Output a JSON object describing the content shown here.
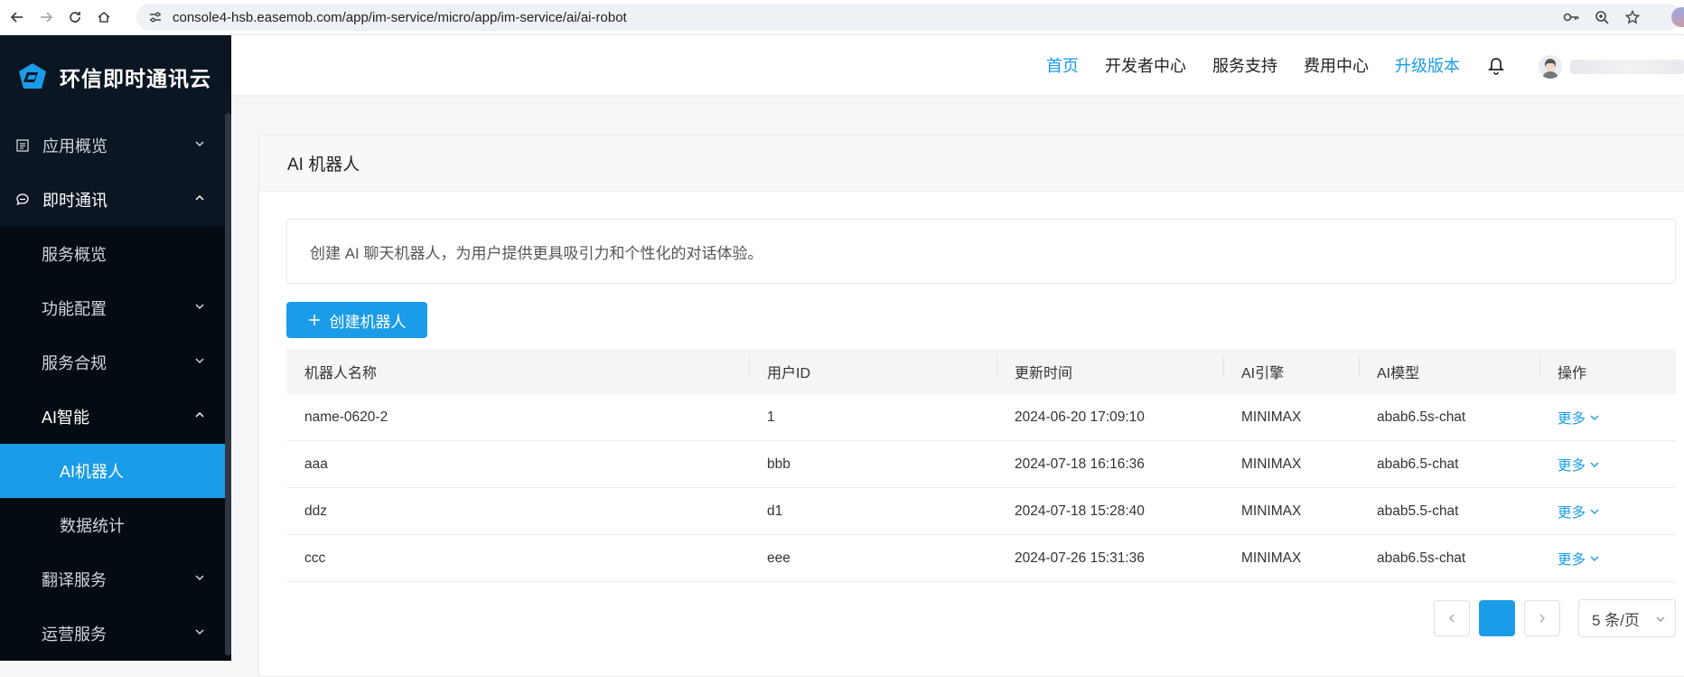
{
  "browser": {
    "url": "console4-hsb.easemob.com/app/im-service/micro/app/im-service/ai/ai-robot"
  },
  "sidebar": {
    "brand": "环信即时通讯云",
    "items": [
      {
        "label": "应用概览"
      },
      {
        "label": "即时通讯"
      },
      {
        "label": "服务概览"
      },
      {
        "label": "功能配置"
      },
      {
        "label": "服务合规"
      },
      {
        "label": "AI智能"
      },
      {
        "label": "AI机器人"
      },
      {
        "label": "数据统计"
      },
      {
        "label": "翻译服务"
      },
      {
        "label": "运营服务"
      }
    ]
  },
  "topnav": {
    "home": "首页",
    "developer": "开发者中心",
    "support": "服务支持",
    "billing": "费用中心",
    "upgrade": "升级版本"
  },
  "page": {
    "title": "AI 机器人",
    "tip": "创建 AI 聊天机器人，为用户提供更具吸引力和个性化的对话体验。",
    "create_button": "创建机器人"
  },
  "table": {
    "columns": [
      "机器人名称",
      "用户ID",
      "更新时间",
      "AI引擎",
      "AI模型",
      "操作"
    ],
    "rows": [
      {
        "name": "name-0620-2",
        "user_id": "1",
        "updated": "2024-06-20 17:09:10",
        "engine": "MINIMAX",
        "model": "abab6.5s-chat",
        "action": "更多"
      },
      {
        "name": "aaa",
        "user_id": "bbb",
        "updated": "2024-07-18 16:16:36",
        "engine": "MINIMAX",
        "model": "abab6.5-chat",
        "action": "更多"
      },
      {
        "name": "ddz",
        "user_id": "d1",
        "updated": "2024-07-18 15:28:40",
        "engine": "MINIMAX",
        "model": "abab5.5-chat",
        "action": "更多"
      },
      {
        "name": "ccc",
        "user_id": "eee",
        "updated": "2024-07-26 15:31:36",
        "engine": "MINIMAX",
        "model": "abab6.5s-chat",
        "action": "更多"
      }
    ]
  },
  "pagination": {
    "page_size": "5 条/页"
  },
  "colors": {
    "accent": "#1a9ce8",
    "sidebar_bg": "#0c1622"
  }
}
